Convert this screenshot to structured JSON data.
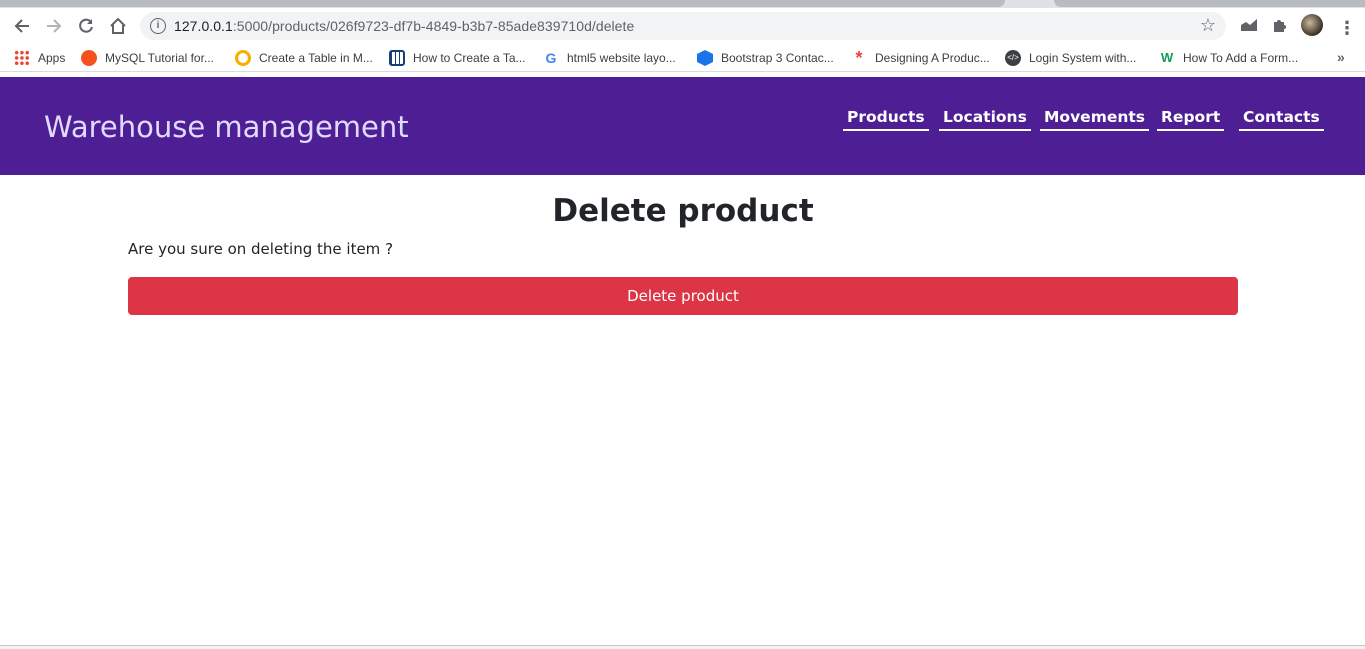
{
  "browser": {
    "url_host": "127.0.0.1",
    "url_path": ":5000/products/026f9723-df7b-4849-b3b7-85ade839710d/delete",
    "bookmarks": [
      {
        "label": "Apps",
        "icon": "apps-grid-icon",
        "color": "#ea4335"
      },
      {
        "label": "MySQL Tutorial for...",
        "icon": "mysql-tutorial-icon",
        "color": "#f4511e"
      },
      {
        "label": "Create a Table in M...",
        "icon": "search-magnifier-icon",
        "color": "#f9ab00"
      },
      {
        "label": "How to Create a Ta...",
        "icon": "table-grid-icon",
        "color": "#1a3c7a"
      },
      {
        "label": "html5 website layo...",
        "icon": "google-icon",
        "color": "#4285f4"
      },
      {
        "label": "Bootstrap 3 Contac...",
        "icon": "hexagon-icon",
        "color": "#1a73e8"
      },
      {
        "label": "Designing A Produc...",
        "icon": "asterisk-icon",
        "color": "#e8453c"
      },
      {
        "label": "Login System with...",
        "icon": "code-icon",
        "color": "#3c4043"
      },
      {
        "label": "How To Add a Form...",
        "icon": "w-logo-icon",
        "color": "#0f9d58"
      }
    ]
  },
  "header": {
    "title": "Warehouse management",
    "nav": [
      {
        "label": "Products"
      },
      {
        "label": "Locations"
      },
      {
        "label": "Movements"
      },
      {
        "label": "Report"
      },
      {
        "label": "Contacts"
      }
    ]
  },
  "main": {
    "heading": "Delete product",
    "confirm_text": "Are you sure on deleting the item ?",
    "delete_button": "Delete product"
  },
  "colors": {
    "header_bg": "#4e1e95",
    "danger": "#dc3545"
  }
}
